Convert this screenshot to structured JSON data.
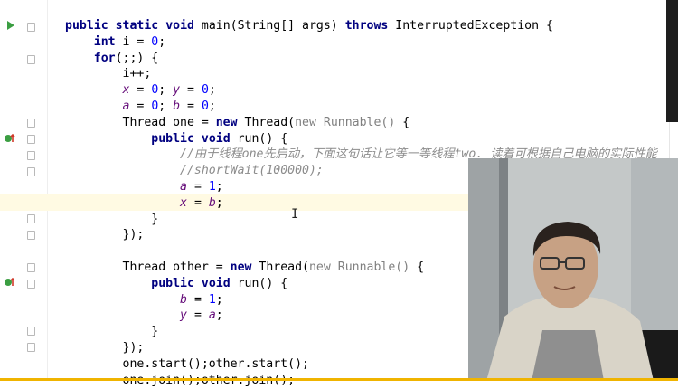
{
  "colors": {
    "keyword": "#000080",
    "field": "#660e7a",
    "number": "#0000ff",
    "comment": "#8c8c8c",
    "run": "#3b9e42"
  },
  "code_lines": [
    [
      "public static void main(String[] args) throws InterruptedException {"
    ],
    [
      "    int i = 0;"
    ],
    [
      "    for(;;) {"
    ],
    [
      "        i++;"
    ],
    [
      "        x = 0; y = 0;"
    ],
    [
      "        a = 0; b = 0;"
    ],
    [
      "        Thread one = new Thread(new Runnable() {"
    ],
    [
      "            public void run() {"
    ],
    [
      "                //由于线程one先启动，下面这句话让它等一等线程two. 读着可根据自己电脑的实际性能"
    ],
    [
      "                //shortWait(100000);"
    ],
    [
      "                a = 1;"
    ],
    [
      "                x = b;"
    ],
    [
      "            }"
    ],
    [
      "        });"
    ],
    [
      ""
    ],
    [
      "        Thread other = new Thread(new Runnable() {"
    ],
    [
      "            public void run() {"
    ],
    [
      "                b = 1;"
    ],
    [
      "                y = a;"
    ],
    [
      "            }"
    ],
    [
      "        });"
    ],
    [
      "        one.start();other.start();"
    ],
    [
      "        one.join();other.join();"
    ]
  ],
  "gutter": {
    "run_icon": "run-arrow-icon",
    "impl_icon": "implement-method-icon"
  },
  "webcam": {
    "subject": "presenter-video-overlay"
  }
}
